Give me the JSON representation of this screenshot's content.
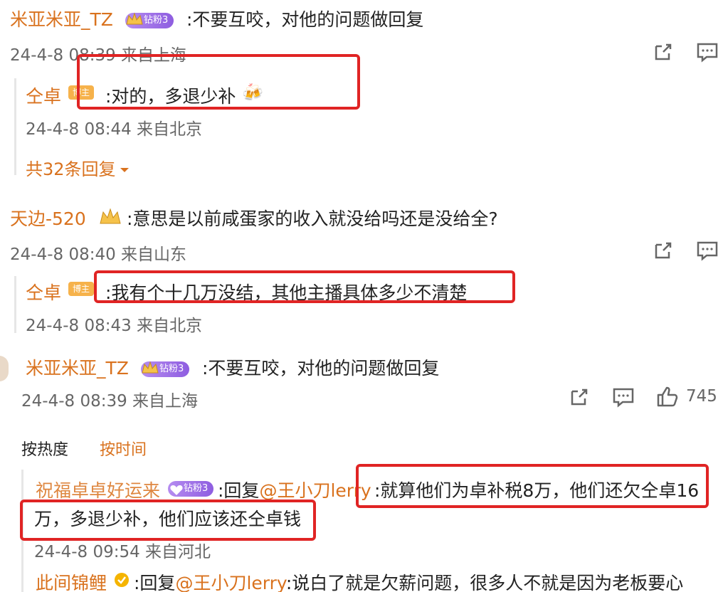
{
  "comments": [
    {
      "user": "米亚米亚_TZ",
      "badge": "钻粉3",
      "text": ":不要互咬，对他的问题做回复",
      "meta": "24-4-8 08:39 来自上海",
      "reply": {
        "user": "仝卓",
        "badge": "博主",
        "text": ":对的，多退少补",
        "meta": "24-4-8 08:44 来自北京"
      },
      "expand": "共32条回复"
    },
    {
      "user": "天边-520",
      "text": ":意思是以前咸蛋家的收入就没给吗还是没给全?",
      "meta": "24-4-8 08:40 来自山东",
      "reply": {
        "user": "仝卓",
        "badge": "博主",
        "text": ":我有个十几万没结，其他主播具体多少不清楚",
        "meta": "24-4-8 08:43 来自北京"
      }
    },
    {
      "user": "米亚米亚_TZ",
      "badge": "钻粉3",
      "text": ":不要互咬，对他的问题做回复",
      "meta": "24-4-8 08:39 来自上海",
      "likes": "745"
    }
  ],
  "sort_tabs": {
    "hot": "按热度",
    "time": "按时间"
  },
  "replies": [
    {
      "user": "祝福卓卓好运来",
      "badge": "钻粉3",
      "prefix": ":回复",
      "mention": "@王小刀lerry",
      "text_line1": ":就算他们为卓补税8万，他们还欠仝卓16",
      "text_line2": "万，多退少补，他们应该还仝卓钱",
      "meta": "24-4-8 09:54 来自河北"
    },
    {
      "user": "此间锦鲤",
      "prefix": ":回复",
      "mention": "@王小刀lerry",
      "text": ":说白了就是欠薪问题，很多人不就是因为老板要心"
    }
  ],
  "icons": [
    "share-icon",
    "comment-icon",
    "like-icon",
    "chevron-down-icon",
    "crown-icon"
  ],
  "colors": {
    "username": "#d9721e",
    "highlight_box": "#e02424",
    "badge_purple": "#8e5de0",
    "badge_orange": "#f6b24b"
  }
}
